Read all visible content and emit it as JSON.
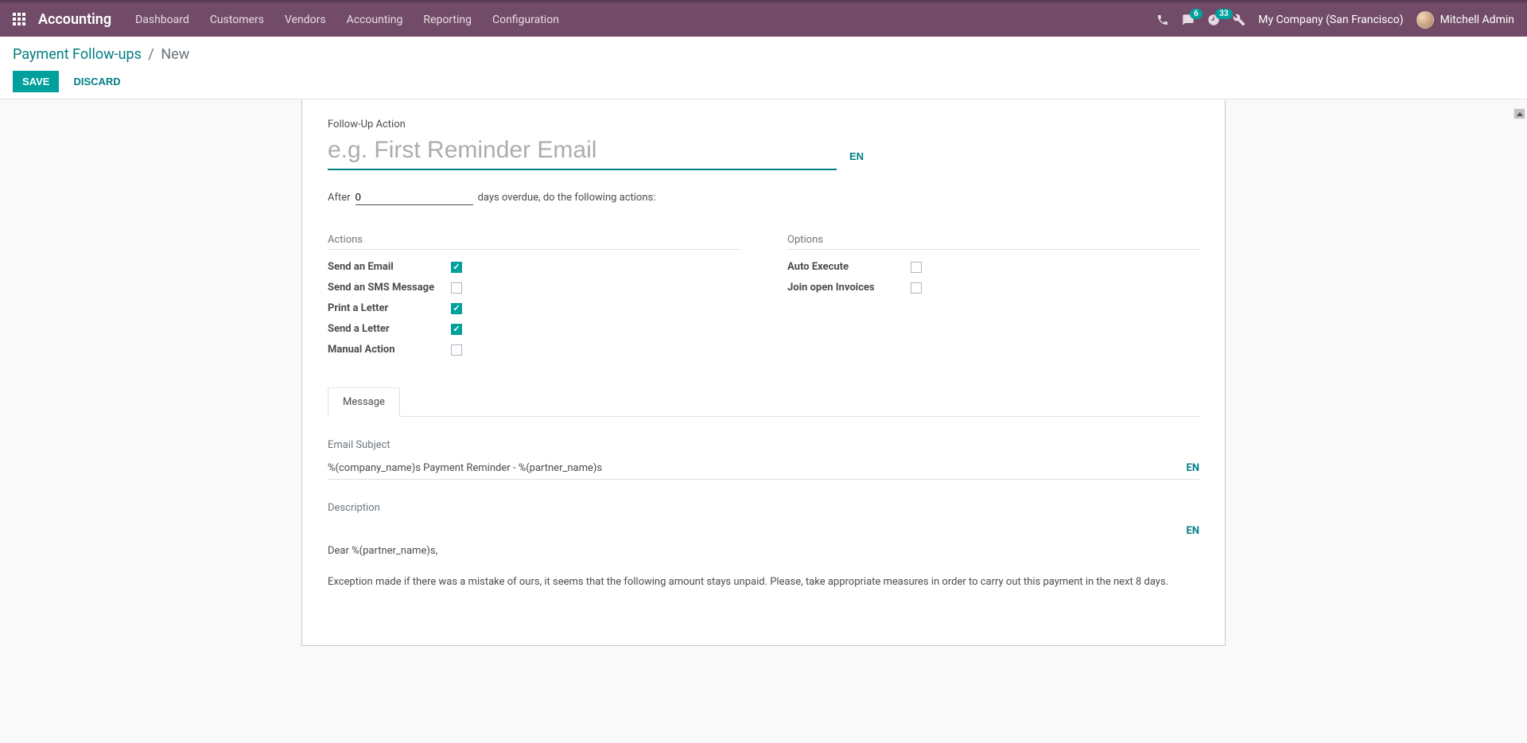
{
  "nav": {
    "brand": "Accounting",
    "menu": [
      "Dashboard",
      "Customers",
      "Vendors",
      "Accounting",
      "Reporting",
      "Configuration"
    ],
    "msg_badge": "6",
    "clock_badge": "33",
    "company": "My Company (San Francisco)",
    "user": "Mitchell Admin"
  },
  "breadcrumb": {
    "parent": "Payment Follow-ups",
    "current": "New"
  },
  "buttons": {
    "save": "SAVE",
    "discard": "DISCARD"
  },
  "form": {
    "followup_label": "Follow-Up Action",
    "title_placeholder": "e.g. First Reminder Email",
    "title_value": "",
    "lang": "EN",
    "after_prefix": "After",
    "after_value": "0",
    "after_suffix": "days overdue, do the following actions:",
    "actions_title": "Actions",
    "options_title": "Options",
    "actions": [
      {
        "label": "Send an Email",
        "checked": true
      },
      {
        "label": "Send an SMS Message",
        "checked": false
      },
      {
        "label": "Print a Letter",
        "checked": true
      },
      {
        "label": "Send a Letter",
        "checked": true
      },
      {
        "label": "Manual Action",
        "checked": false
      }
    ],
    "options": [
      {
        "label": "Auto Execute",
        "checked": false
      },
      {
        "label": "Join open Invoices",
        "checked": false
      }
    ],
    "tab_message": "Message",
    "email_subject_label": "Email Subject",
    "email_subject_value": "%(company_name)s Payment Reminder - %(partner_name)s",
    "description_label": "Description",
    "description_p1": "Dear %(partner_name)s,",
    "description_p2": "Exception made if there was a mistake of ours, it seems that the following amount stays unpaid. Please, take appropriate measures in order to carry out this payment in the next 8 days."
  }
}
